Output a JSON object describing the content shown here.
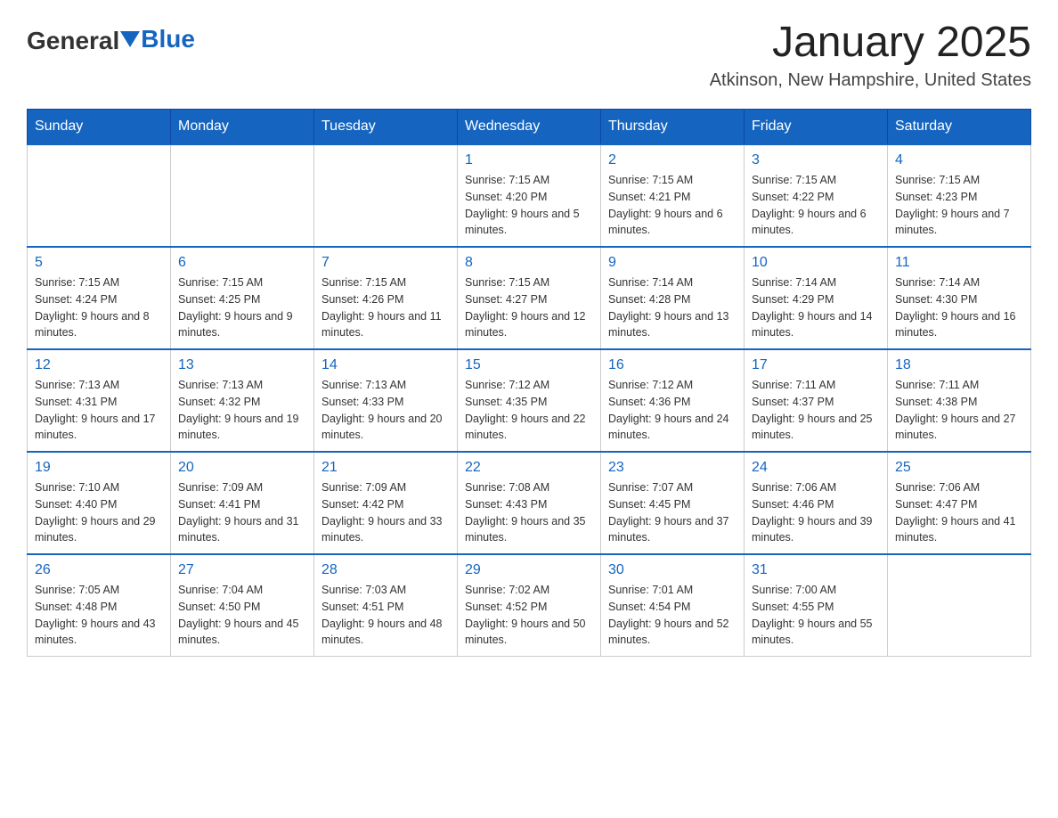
{
  "header": {
    "logo_general": "General",
    "logo_blue": "Blue",
    "title": "January 2025",
    "subtitle": "Atkinson, New Hampshire, United States"
  },
  "days_of_week": [
    "Sunday",
    "Monday",
    "Tuesday",
    "Wednesday",
    "Thursday",
    "Friday",
    "Saturday"
  ],
  "weeks": [
    [
      {
        "day": "",
        "info": ""
      },
      {
        "day": "",
        "info": ""
      },
      {
        "day": "",
        "info": ""
      },
      {
        "day": "1",
        "info": "Sunrise: 7:15 AM\nSunset: 4:20 PM\nDaylight: 9 hours and 5 minutes."
      },
      {
        "day": "2",
        "info": "Sunrise: 7:15 AM\nSunset: 4:21 PM\nDaylight: 9 hours and 6 minutes."
      },
      {
        "day": "3",
        "info": "Sunrise: 7:15 AM\nSunset: 4:22 PM\nDaylight: 9 hours and 6 minutes."
      },
      {
        "day": "4",
        "info": "Sunrise: 7:15 AM\nSunset: 4:23 PM\nDaylight: 9 hours and 7 minutes."
      }
    ],
    [
      {
        "day": "5",
        "info": "Sunrise: 7:15 AM\nSunset: 4:24 PM\nDaylight: 9 hours and 8 minutes."
      },
      {
        "day": "6",
        "info": "Sunrise: 7:15 AM\nSunset: 4:25 PM\nDaylight: 9 hours and 9 minutes."
      },
      {
        "day": "7",
        "info": "Sunrise: 7:15 AM\nSunset: 4:26 PM\nDaylight: 9 hours and 11 minutes."
      },
      {
        "day": "8",
        "info": "Sunrise: 7:15 AM\nSunset: 4:27 PM\nDaylight: 9 hours and 12 minutes."
      },
      {
        "day": "9",
        "info": "Sunrise: 7:14 AM\nSunset: 4:28 PM\nDaylight: 9 hours and 13 minutes."
      },
      {
        "day": "10",
        "info": "Sunrise: 7:14 AM\nSunset: 4:29 PM\nDaylight: 9 hours and 14 minutes."
      },
      {
        "day": "11",
        "info": "Sunrise: 7:14 AM\nSunset: 4:30 PM\nDaylight: 9 hours and 16 minutes."
      }
    ],
    [
      {
        "day": "12",
        "info": "Sunrise: 7:13 AM\nSunset: 4:31 PM\nDaylight: 9 hours and 17 minutes."
      },
      {
        "day": "13",
        "info": "Sunrise: 7:13 AM\nSunset: 4:32 PM\nDaylight: 9 hours and 19 minutes."
      },
      {
        "day": "14",
        "info": "Sunrise: 7:13 AM\nSunset: 4:33 PM\nDaylight: 9 hours and 20 minutes."
      },
      {
        "day": "15",
        "info": "Sunrise: 7:12 AM\nSunset: 4:35 PM\nDaylight: 9 hours and 22 minutes."
      },
      {
        "day": "16",
        "info": "Sunrise: 7:12 AM\nSunset: 4:36 PM\nDaylight: 9 hours and 24 minutes."
      },
      {
        "day": "17",
        "info": "Sunrise: 7:11 AM\nSunset: 4:37 PM\nDaylight: 9 hours and 25 minutes."
      },
      {
        "day": "18",
        "info": "Sunrise: 7:11 AM\nSunset: 4:38 PM\nDaylight: 9 hours and 27 minutes."
      }
    ],
    [
      {
        "day": "19",
        "info": "Sunrise: 7:10 AM\nSunset: 4:40 PM\nDaylight: 9 hours and 29 minutes."
      },
      {
        "day": "20",
        "info": "Sunrise: 7:09 AM\nSunset: 4:41 PM\nDaylight: 9 hours and 31 minutes."
      },
      {
        "day": "21",
        "info": "Sunrise: 7:09 AM\nSunset: 4:42 PM\nDaylight: 9 hours and 33 minutes."
      },
      {
        "day": "22",
        "info": "Sunrise: 7:08 AM\nSunset: 4:43 PM\nDaylight: 9 hours and 35 minutes."
      },
      {
        "day": "23",
        "info": "Sunrise: 7:07 AM\nSunset: 4:45 PM\nDaylight: 9 hours and 37 minutes."
      },
      {
        "day": "24",
        "info": "Sunrise: 7:06 AM\nSunset: 4:46 PM\nDaylight: 9 hours and 39 minutes."
      },
      {
        "day": "25",
        "info": "Sunrise: 7:06 AM\nSunset: 4:47 PM\nDaylight: 9 hours and 41 minutes."
      }
    ],
    [
      {
        "day": "26",
        "info": "Sunrise: 7:05 AM\nSunset: 4:48 PM\nDaylight: 9 hours and 43 minutes."
      },
      {
        "day": "27",
        "info": "Sunrise: 7:04 AM\nSunset: 4:50 PM\nDaylight: 9 hours and 45 minutes."
      },
      {
        "day": "28",
        "info": "Sunrise: 7:03 AM\nSunset: 4:51 PM\nDaylight: 9 hours and 48 minutes."
      },
      {
        "day": "29",
        "info": "Sunrise: 7:02 AM\nSunset: 4:52 PM\nDaylight: 9 hours and 50 minutes."
      },
      {
        "day": "30",
        "info": "Sunrise: 7:01 AM\nSunset: 4:54 PM\nDaylight: 9 hours and 52 minutes."
      },
      {
        "day": "31",
        "info": "Sunrise: 7:00 AM\nSunset: 4:55 PM\nDaylight: 9 hours and 55 minutes."
      },
      {
        "day": "",
        "info": ""
      }
    ]
  ]
}
